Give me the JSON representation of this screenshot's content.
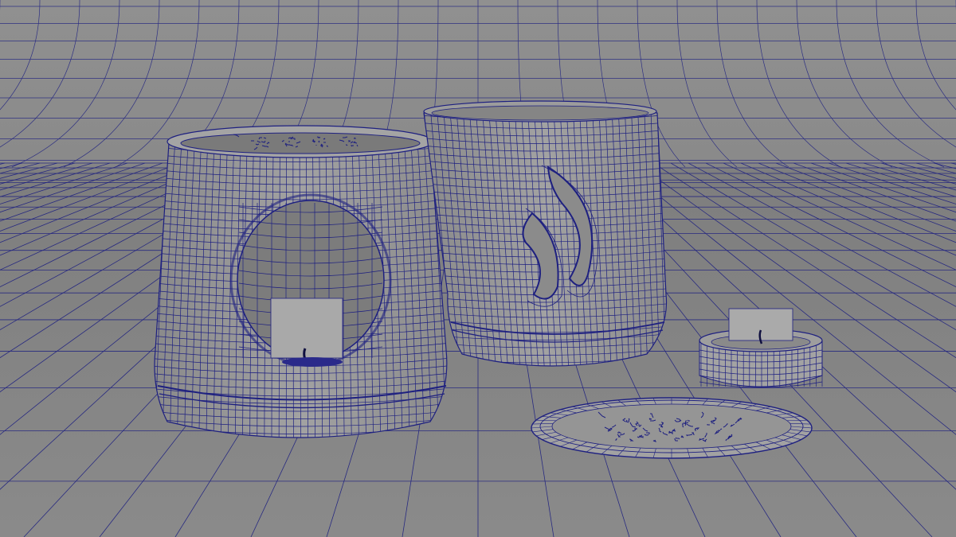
{
  "viewport": {
    "render_mode": "wireframe-on-shaded",
    "wire_color": "#1a1a80",
    "background_color": "#8e8e8e",
    "floor_color": "#979797"
  },
  "objects": [
    {
      "name": "lantern-round-window",
      "cutout": "circle",
      "shows_candle": true
    },
    {
      "name": "lantern-flame-cutout",
      "cutout": "flame"
    },
    {
      "name": "tealight-candle",
      "shows_candle": true
    },
    {
      "name": "ash-plate",
      "contents": "ash"
    }
  ]
}
